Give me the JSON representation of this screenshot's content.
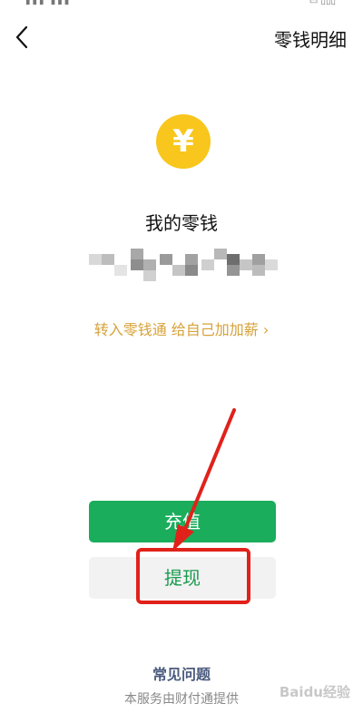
{
  "header": {
    "title": "零钱明细"
  },
  "balance": {
    "label": "我的零钱",
    "currency_icon": "yen-icon",
    "currency_symbol": "¥"
  },
  "promo": {
    "text": "转入零钱通 给自己加加薪 ›"
  },
  "actions": {
    "recharge_label": "充值",
    "withdraw_label": "提现"
  },
  "footer": {
    "faq": "常见问题",
    "provider": "本服务由财付通提供"
  },
  "watermark": {
    "text": "Baidu经验"
  },
  "colors": {
    "coin": "#f8c61c",
    "recharge_bg": "#1aad5c",
    "withdraw_text": "#1a9a4f",
    "promo": "#d6a23a",
    "annotation": "#e0221a",
    "faq": "#4a5a7d"
  }
}
